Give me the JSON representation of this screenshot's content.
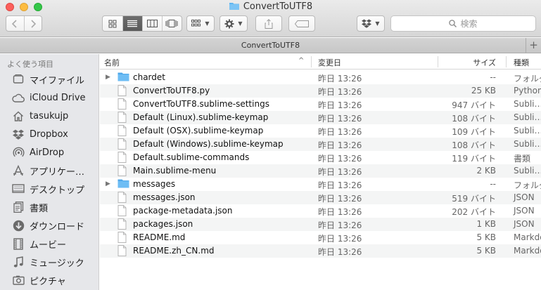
{
  "window": {
    "title": "ConvertToUTF8"
  },
  "toolbar": {
    "search_placeholder": "検索"
  },
  "pathbar": {
    "label": "ConvertToUTF8",
    "add_label": "+"
  },
  "sidebar": {
    "heading": "よく使う項目",
    "items": [
      {
        "label": "マイファイル",
        "icon": "all-files-icon"
      },
      {
        "label": "iCloud Drive",
        "icon": "cloud-icon"
      },
      {
        "label": "tasukujp",
        "icon": "home-icon"
      },
      {
        "label": "Dropbox",
        "icon": "dropbox-icon"
      },
      {
        "label": "AirDrop",
        "icon": "airdrop-icon"
      },
      {
        "label": "アプリケー…",
        "icon": "applications-icon"
      },
      {
        "label": "デスクトップ",
        "icon": "desktop-icon"
      },
      {
        "label": "書類",
        "icon": "documents-icon"
      },
      {
        "label": "ダウンロード",
        "icon": "downloads-icon"
      },
      {
        "label": "ムービー",
        "icon": "movies-icon"
      },
      {
        "label": "ミュージック",
        "icon": "music-icon"
      },
      {
        "label": "ピクチャ",
        "icon": "pictures-icon"
      }
    ]
  },
  "list": {
    "columns": {
      "name": "名前",
      "date": "変更日",
      "size": "サイズ",
      "kind": "種類"
    },
    "rows": [
      {
        "name": "chardet",
        "date": "昨日 13:26",
        "size": "--",
        "kind": "フォルダ",
        "folder": true
      },
      {
        "name": "ConvertToUTF8.py",
        "date": "昨日 13:26",
        "size": "25 KB",
        "kind": "Python",
        "folder": false
      },
      {
        "name": "ConvertToUTF8.sublime-settings",
        "date": "昨日 13:26",
        "size": "947 バイト",
        "kind": "Subli…",
        "folder": false
      },
      {
        "name": "Default (Linux).sublime-keymap",
        "date": "昨日 13:26",
        "size": "108 バイト",
        "kind": "Subli…",
        "folder": false
      },
      {
        "name": "Default (OSX).sublime-keymap",
        "date": "昨日 13:26",
        "size": "109 バイト",
        "kind": "Subli…",
        "folder": false
      },
      {
        "name": "Default (Windows).sublime-keymap",
        "date": "昨日 13:26",
        "size": "108 バイト",
        "kind": "Subli…",
        "folder": false
      },
      {
        "name": "Default.sublime-commands",
        "date": "昨日 13:26",
        "size": "119 バイト",
        "kind": "書類",
        "folder": false
      },
      {
        "name": "Main.sublime-menu",
        "date": "昨日 13:26",
        "size": "2 KB",
        "kind": "Subli…",
        "folder": false
      },
      {
        "name": "messages",
        "date": "昨日 13:26",
        "size": "--",
        "kind": "フォルダ",
        "folder": true
      },
      {
        "name": "messages.json",
        "date": "昨日 13:26",
        "size": "519 バイト",
        "kind": "JSON",
        "folder": false
      },
      {
        "name": "package-metadata.json",
        "date": "昨日 13:26",
        "size": "202 バイト",
        "kind": "JSON",
        "folder": false
      },
      {
        "name": "packages.json",
        "date": "昨日 13:26",
        "size": "1 KB",
        "kind": "JSON",
        "folder": false
      },
      {
        "name": "README.md",
        "date": "昨日 13:26",
        "size": "5 KB",
        "kind": "Markdown",
        "folder": false
      },
      {
        "name": "README.zh_CN.md",
        "date": "昨日 13:26",
        "size": "5 KB",
        "kind": "Markdown",
        "folder": false
      }
    ]
  },
  "colors": {
    "folder": "#5fb5f0",
    "sidebar_bg": "#e6e7ea",
    "close": "#fc605c",
    "minimize": "#fdbc40",
    "maximize": "#34c749"
  }
}
